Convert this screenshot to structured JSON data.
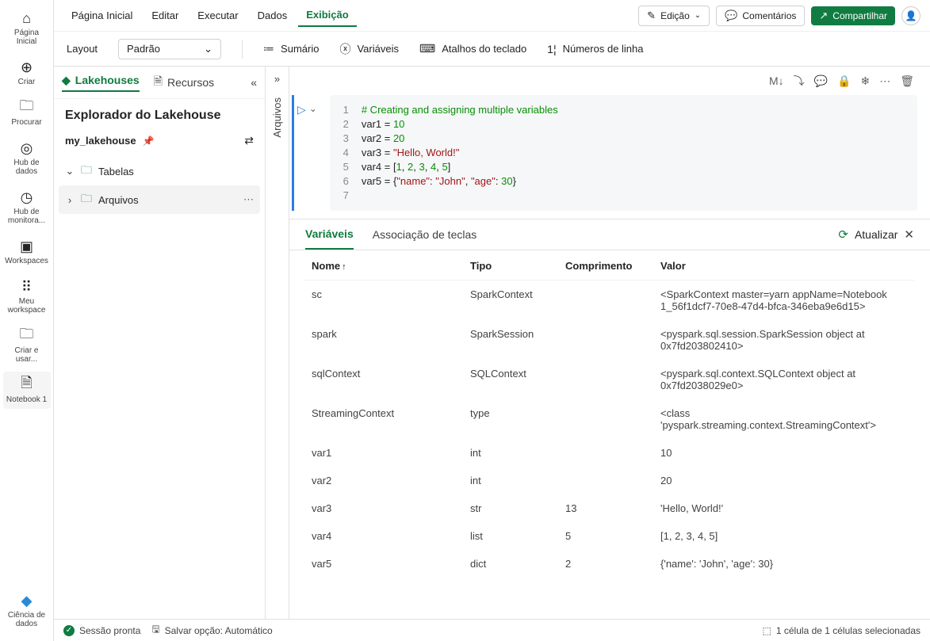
{
  "leftbar": {
    "items": [
      {
        "icon": "⌂",
        "label": "Página Inicial"
      },
      {
        "icon": "⊕",
        "label": "Criar"
      },
      {
        "icon": "🗀",
        "label": "Procurar"
      },
      {
        "icon": "◎",
        "label": "Hub de dados"
      },
      {
        "icon": "◷",
        "label": "Hub de monitora..."
      },
      {
        "icon": "▣",
        "label": "Workspaces"
      },
      {
        "icon": "⠿",
        "label": "Meu workspace"
      },
      {
        "icon": "🗀",
        "label": "Criar e usar..."
      },
      {
        "icon": "🗎",
        "label": "Notebook 1"
      }
    ],
    "bottom": {
      "icon": "◆",
      "label": "Ciência de dados"
    }
  },
  "menubar": {
    "items": [
      "Página Inicial",
      "Editar",
      "Executar",
      "Dados",
      "Exibição"
    ],
    "activeIndex": 4,
    "edit_btn": "Edição",
    "comments_btn": "Comentários",
    "share_btn": "Compartilhar"
  },
  "ribbon": {
    "layout_label": "Layout",
    "layout_value": "Padrão",
    "summary": "Sumário",
    "variables": "Variáveis",
    "shortcuts": "Atalhos do teclado",
    "linenumbers": "Números de linha"
  },
  "explorer": {
    "tabs": {
      "lakehouses": "Lakehouses",
      "resources": "Recursos"
    },
    "title": "Explorador do Lakehouse",
    "lake_name": "my_lakehouse",
    "tree": [
      {
        "icon": "🗀",
        "label": "Tabelas",
        "expandable": true,
        "expanded": true
      },
      {
        "icon": "🗀",
        "label": "Arquivos",
        "expandable": true,
        "expanded": false,
        "hover": true
      }
    ]
  },
  "vtab": {
    "label": "Arquivos"
  },
  "cell_toolbar": {
    "md": "M↓"
  },
  "code": {
    "lines": [
      {
        "n": "1",
        "html": "<span class='py-comment'># Creating and assigning multiple variables</span>"
      },
      {
        "n": "2",
        "html": "var1 = <span class='py-num'>10</span>"
      },
      {
        "n": "3",
        "html": "var2 = <span class='py-num'>20</span>"
      },
      {
        "n": "4",
        "html": "var3 = <span class='py-str'>\"Hello, World!\"</span>"
      },
      {
        "n": "5",
        "html": "var4 = [<span class='py-num'>1</span>, <span class='py-num'>2</span>, <span class='py-num'>3</span>, <span class='py-num'>4</span>, <span class='py-num'>5</span>]"
      },
      {
        "n": "6",
        "html": "var5 = {<span class='py-key'>\"name\"</span>: <span class='py-str'>\"John\"</span>, <span class='py-key'>\"age\"</span>: <span class='py-num'>30</span>}"
      },
      {
        "n": "7",
        "html": ""
      }
    ]
  },
  "varpanel": {
    "tabs": {
      "variables": "Variáveis",
      "keybind": "Associação de teclas"
    },
    "refresh": "Atualizar",
    "columns": {
      "name": "Nome",
      "type": "Tipo",
      "length": "Comprimento",
      "value": "Valor"
    },
    "rows": [
      {
        "name": "sc",
        "type": "SparkContext",
        "length": "",
        "value": "<SparkContext master=yarn appName=Notebook 1_56f1dcf7-70e8-47d4-bfca-346eba9e6d15>"
      },
      {
        "name": "spark",
        "type": "SparkSession",
        "length": "",
        "value": "<pyspark.sql.session.SparkSession object at 0x7fd203802410>"
      },
      {
        "name": "sqlContext",
        "type": "SQLContext",
        "length": "",
        "value": "<pyspark.sql.context.SQLContext object at 0x7fd2038029e0>"
      },
      {
        "name": "StreamingContext",
        "type": "type",
        "length": "",
        "value": "<class 'pyspark.streaming.context.StreamingContext'>"
      },
      {
        "name": "var1",
        "type": "int",
        "length": "",
        "value": "10"
      },
      {
        "name": "var2",
        "type": "int",
        "length": "",
        "value": "20"
      },
      {
        "name": "var3",
        "type": "str",
        "length": "13",
        "value": "'Hello, World!'"
      },
      {
        "name": "var4",
        "type": "list",
        "length": "5",
        "value": "[1, 2, 3, 4, 5]"
      },
      {
        "name": "var5",
        "type": "dict",
        "length": "2",
        "value": "{'name': 'John', 'age': 30}"
      }
    ]
  },
  "statusbar": {
    "session": "Sessão pronta",
    "save": "Salvar opção: Automático",
    "selection": "1 célula de 1 células selecionadas"
  }
}
